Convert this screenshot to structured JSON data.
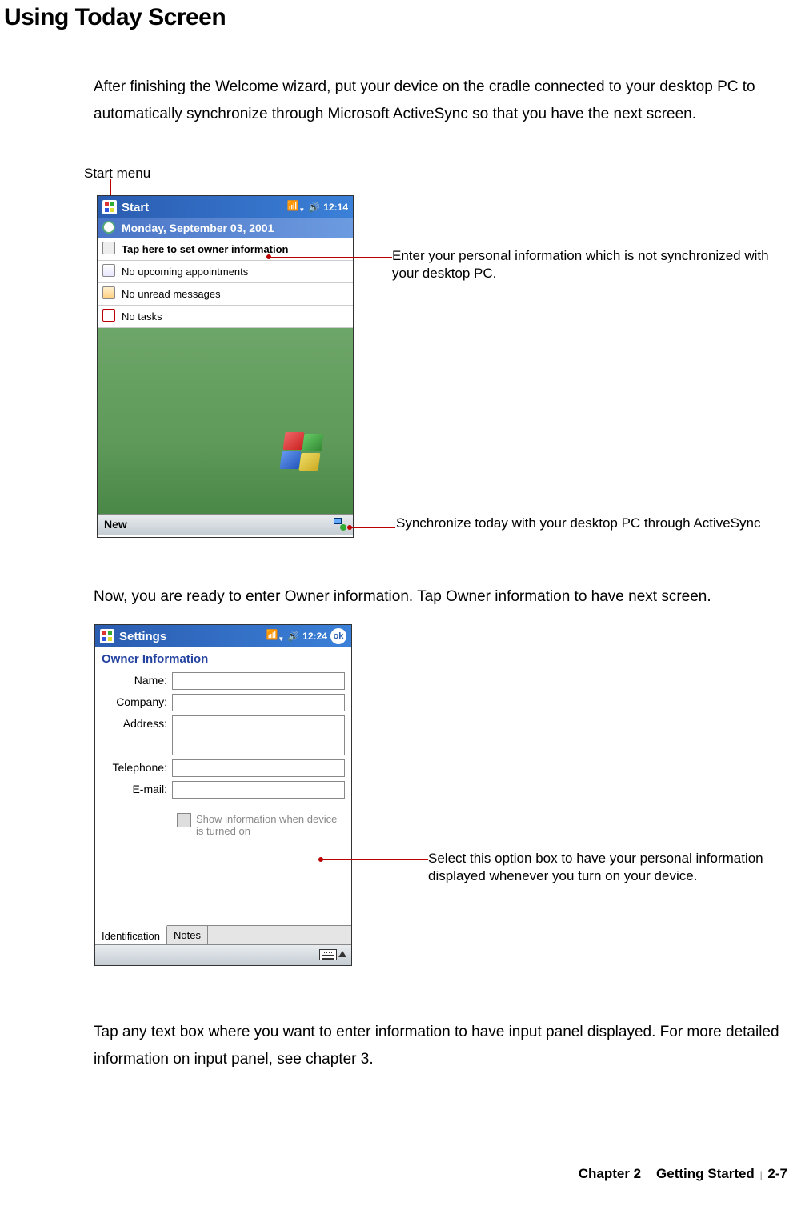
{
  "heading": "Using Today Screen",
  "intro": "After finishing the Welcome wizard, put your device on the cradle connected to your desktop PC to automatically synchronize through Microsoft ActiveSync so that you have the next screen.",
  "labels": {
    "start_menu": "Start menu"
  },
  "shot1": {
    "title": "Start",
    "signal": "x",
    "time": "12:14",
    "date": "Monday, September 03, 2001",
    "rows": {
      "owner": "Tap here to set owner information",
      "appts": "No upcoming appointments",
      "inbox": "No unread messages",
      "tasks": "No tasks"
    },
    "new_label": "New"
  },
  "callouts": {
    "owner": "Enter your personal information which is not synchronized with your desktop PC.",
    "sync": "Synchronize today with your desktop PC through ActiveSync",
    "showinfo": "Select this option box to have your personal information displayed whenever you turn on your device."
  },
  "para2": "Now, you are ready to enter Owner information. Tap Owner information to have next screen.",
  "shot2": {
    "title": "Settings",
    "time": "12:24",
    "ok": "ok",
    "panel_title": "Owner Information",
    "fields": {
      "name": "Name:",
      "company": "Company:",
      "address": "Address:",
      "telephone": "Telephone:",
      "email": "E-mail:"
    },
    "checkbox_label": "Show information when device is turned on",
    "tabs": {
      "id": "Identification",
      "notes": "Notes"
    }
  },
  "para3": "Tap any text box where you want to enter information to have input panel displayed. For more detailed information on input panel, see chapter 3.",
  "footer": {
    "chapter": "Chapter 2",
    "section": "Getting Started",
    "page": "2-7"
  }
}
